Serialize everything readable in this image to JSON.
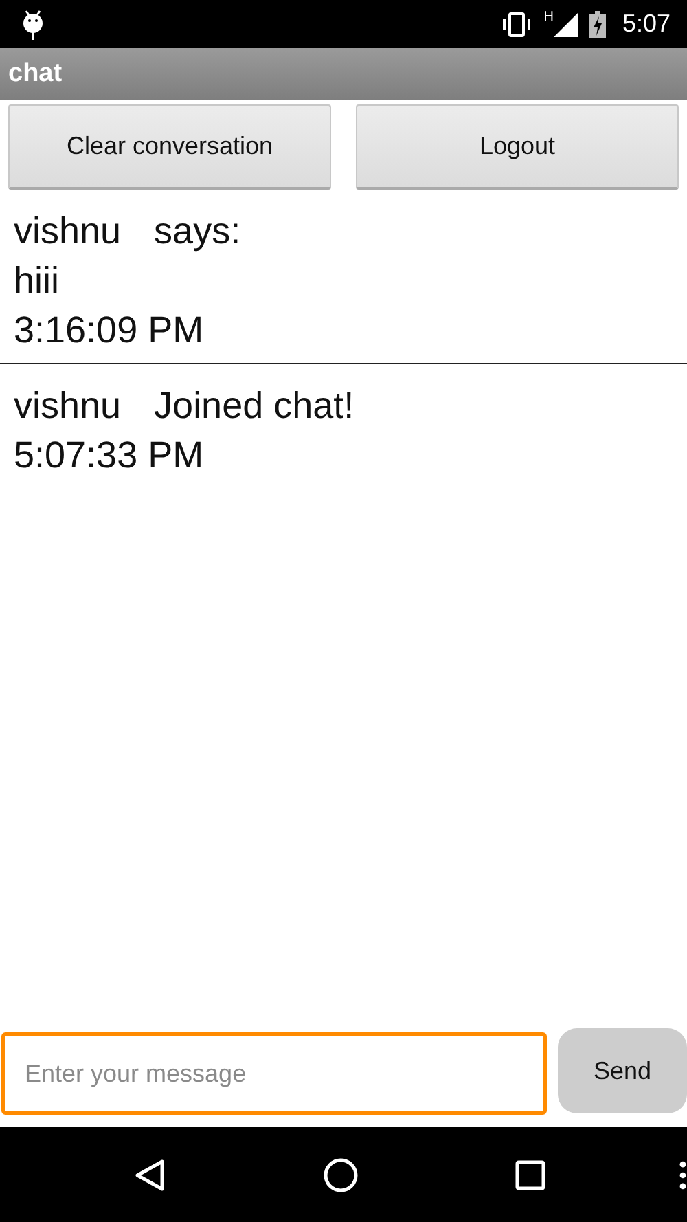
{
  "status_bar": {
    "network": "H",
    "time": "5:07"
  },
  "action_bar": {
    "title": "chat"
  },
  "buttons": [
    "Clear conversation",
    "Logout"
  ],
  "messages": [
    {
      "name": "vishnu",
      "action": "says:",
      "body": "hiii",
      "time": "3:16:09 PM"
    },
    {
      "name": "vishnu",
      "action": "Joined chat!",
      "time": "5:07:33 PM"
    }
  ],
  "composer": {
    "placeholder": "Enter your message",
    "send": "Send"
  }
}
